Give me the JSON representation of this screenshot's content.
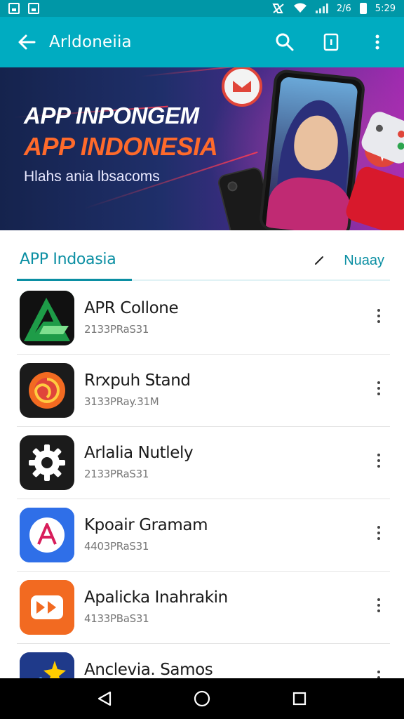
{
  "status_bar": {
    "time": "5:29",
    "network_label": "2/6",
    "icons": [
      "image-icon",
      "photo-icon",
      "nfc-icon",
      "wifi-icon",
      "signal-icon",
      "battery-icon"
    ]
  },
  "app_bar": {
    "title": "Arldoneiia",
    "back_icon": "arrow-left-icon",
    "actions": [
      "search-icon",
      "tablet-icon",
      "more-vert-icon"
    ]
  },
  "banner": {
    "line1": "APP INPONGEM",
    "line2": "APP INDONESIA",
    "subtitle": "Hlahs ania lbsacoms",
    "colors": {
      "line2": "#ff6a2b",
      "background_start": "#15234d",
      "background_end": "#a12bb0"
    }
  },
  "tabs": {
    "active": "APP Indoasia",
    "edit_icon": "pencil-icon",
    "link": "Nuaay"
  },
  "apps": [
    {
      "name": "APR Collone",
      "meta": "2133PRaS31",
      "icon": "arrow-a-icon",
      "icon_bg": "#0f6b2e"
    },
    {
      "name": "Rrxpuh Stand",
      "meta": "3133PRay.31M",
      "icon": "spiral-icon",
      "icon_bg": "#1b1b1b"
    },
    {
      "name": "Arlalia Nutlely",
      "meta": "2133PRaS31",
      "icon": "gear-icon",
      "icon_bg": "#1b1b1b"
    },
    {
      "name": "Kpoair Gramam",
      "meta": "4403PRaS31",
      "icon": "a-logo-icon",
      "icon_bg": "#2f6fe8"
    },
    {
      "name": "Apalicka Inahrakin",
      "meta": "4133PBaS31",
      "icon": "video-play-icon",
      "icon_bg": "#f26a21"
    },
    {
      "name": "Anclevia. Samos",
      "meta": "",
      "icon": "star-icon",
      "icon_bg": "#1f3a8a"
    }
  ],
  "nav_bar": {
    "buttons": [
      "back-triangle-icon",
      "home-circle-icon",
      "recents-square-icon"
    ]
  },
  "accent_color": "#00acc1"
}
